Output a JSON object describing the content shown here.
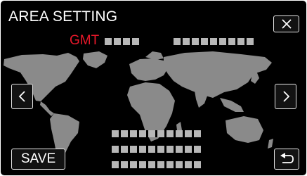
{
  "header": {
    "title": "AREA SETTING",
    "close_icon": "close-icon"
  },
  "timezone": {
    "label": "GMT",
    "offset_value": "",
    "area_value": ""
  },
  "navigation": {
    "prev_icon": "chevron-left-icon",
    "next_icon": "chevron-right-icon"
  },
  "city_list": {
    "lines": [
      "",
      "",
      ""
    ]
  },
  "footer": {
    "save_label": "SAVE",
    "back_icon": "return-icon"
  },
  "colors": {
    "background": "#000000",
    "accent": "#e8182a",
    "map": "#8a8a8a",
    "button_border": "#e6e6e6",
    "text": "#ffffff"
  }
}
